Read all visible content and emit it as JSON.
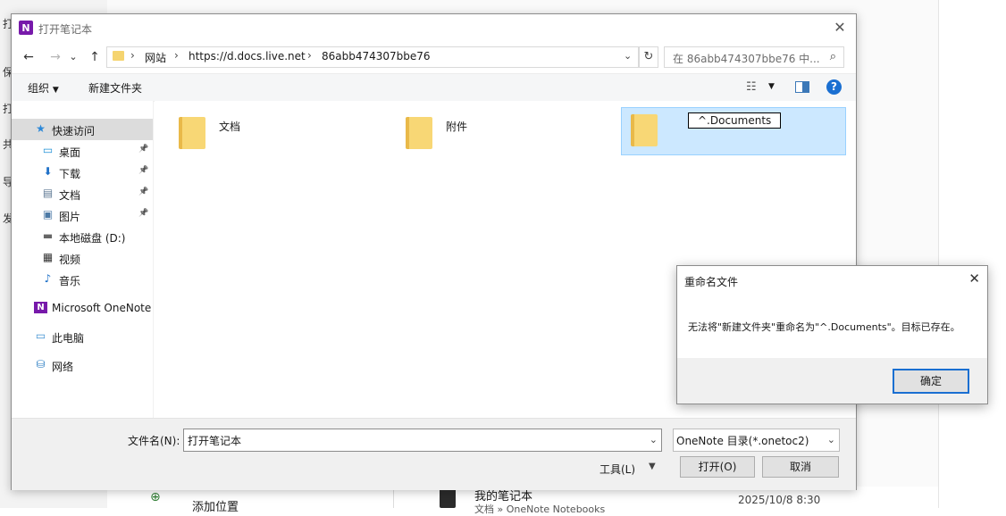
{
  "background": {
    "side_chars": [
      "打",
      "保",
      "打",
      "共",
      "导",
      "发"
    ],
    "bottom_add_location": "添加位置",
    "bottom_notebook_title": "我的笔记本",
    "bottom_notebook_sub": "文档 » OneNote Notebooks",
    "bottom_date": "2025/10/8 8:30"
  },
  "dialog": {
    "app_icon_letter": "N",
    "title": "打开笔记本",
    "close_glyph": "✕",
    "nav": {
      "back": "←",
      "forward": "→",
      "recent": "⌄",
      "up": "↑"
    },
    "address": {
      "segments": [
        "网站",
        "https://d.docs.live.net",
        "86abb474307bbe76"
      ],
      "separator": "›"
    },
    "search_placeholder": "在 86abb474307bbe76 中...",
    "toolbar": {
      "organize": "组织",
      "new_folder": "新建文件夹"
    },
    "nav_pane": [
      {
        "label": "快速访问",
        "icon": "star-icon",
        "glyph": "★",
        "color": "#2b88d8",
        "pinned": false,
        "selected": true,
        "indent": 1
      },
      {
        "label": "桌面",
        "icon": "desktop-icon",
        "glyph": "▭",
        "color": "#1e90d6",
        "pinned": true,
        "selected": false,
        "indent": 2
      },
      {
        "label": "下载",
        "icon": "download-icon",
        "glyph": "⬇",
        "color": "#1e70c8",
        "pinned": true,
        "selected": false,
        "indent": 2
      },
      {
        "label": "文档",
        "icon": "document-icon",
        "glyph": "▤",
        "color": "#5f7a94",
        "pinned": true,
        "selected": false,
        "indent": 2
      },
      {
        "label": "图片",
        "icon": "picture-icon",
        "glyph": "▣",
        "color": "#4c7aa6",
        "pinned": true,
        "selected": false,
        "indent": 2
      },
      {
        "label": "本地磁盘 (D:)",
        "icon": "disk-icon",
        "glyph": "▬",
        "color": "#666666",
        "pinned": false,
        "selected": false,
        "indent": 2
      },
      {
        "label": "视频",
        "icon": "video-icon",
        "glyph": "▦",
        "color": "#333333",
        "pinned": false,
        "selected": false,
        "indent": 2
      },
      {
        "label": "音乐",
        "icon": "music-icon",
        "glyph": "♪",
        "color": "#1e70c8",
        "pinned": false,
        "selected": false,
        "indent": 2
      },
      {
        "label": "Microsoft OneNote",
        "icon": "onenote-icon",
        "glyph": "N",
        "color": "#7719aa",
        "pinned": false,
        "selected": false,
        "indent": 1
      },
      {
        "label": "此电脑",
        "icon": "computer-icon",
        "glyph": "▭",
        "color": "#3d8fd1",
        "pinned": false,
        "selected": false,
        "indent": 1
      },
      {
        "label": "网络",
        "icon": "network-icon",
        "glyph": "⛁",
        "color": "#2d7fc4",
        "pinned": false,
        "selected": false,
        "indent": 1
      }
    ],
    "folders": [
      {
        "label": "文档",
        "selected": false
      },
      {
        "label": "附件",
        "selected": false
      },
      {
        "label": "^.Documents",
        "selected": true,
        "renaming": true
      }
    ],
    "filename_label": "文件名(N):",
    "filename_value": "打开笔记本",
    "filetype_value": "OneNote 目录(*.onetoc2)",
    "tools_label": "工具(L)",
    "open_button": "打开(O)",
    "cancel_button": "取消"
  },
  "rename_dialog": {
    "title": "重命名文件",
    "message": "无法将\"新建文件夹\"重命名为\"^.Documents\"。目标已存在。",
    "ok_button": "确定",
    "close_glyph": "✕"
  },
  "colors": {
    "accent": "#1a6fd1",
    "selection": "#cce8ff",
    "onenote": "#7719aa",
    "folder": "#f8d775"
  }
}
